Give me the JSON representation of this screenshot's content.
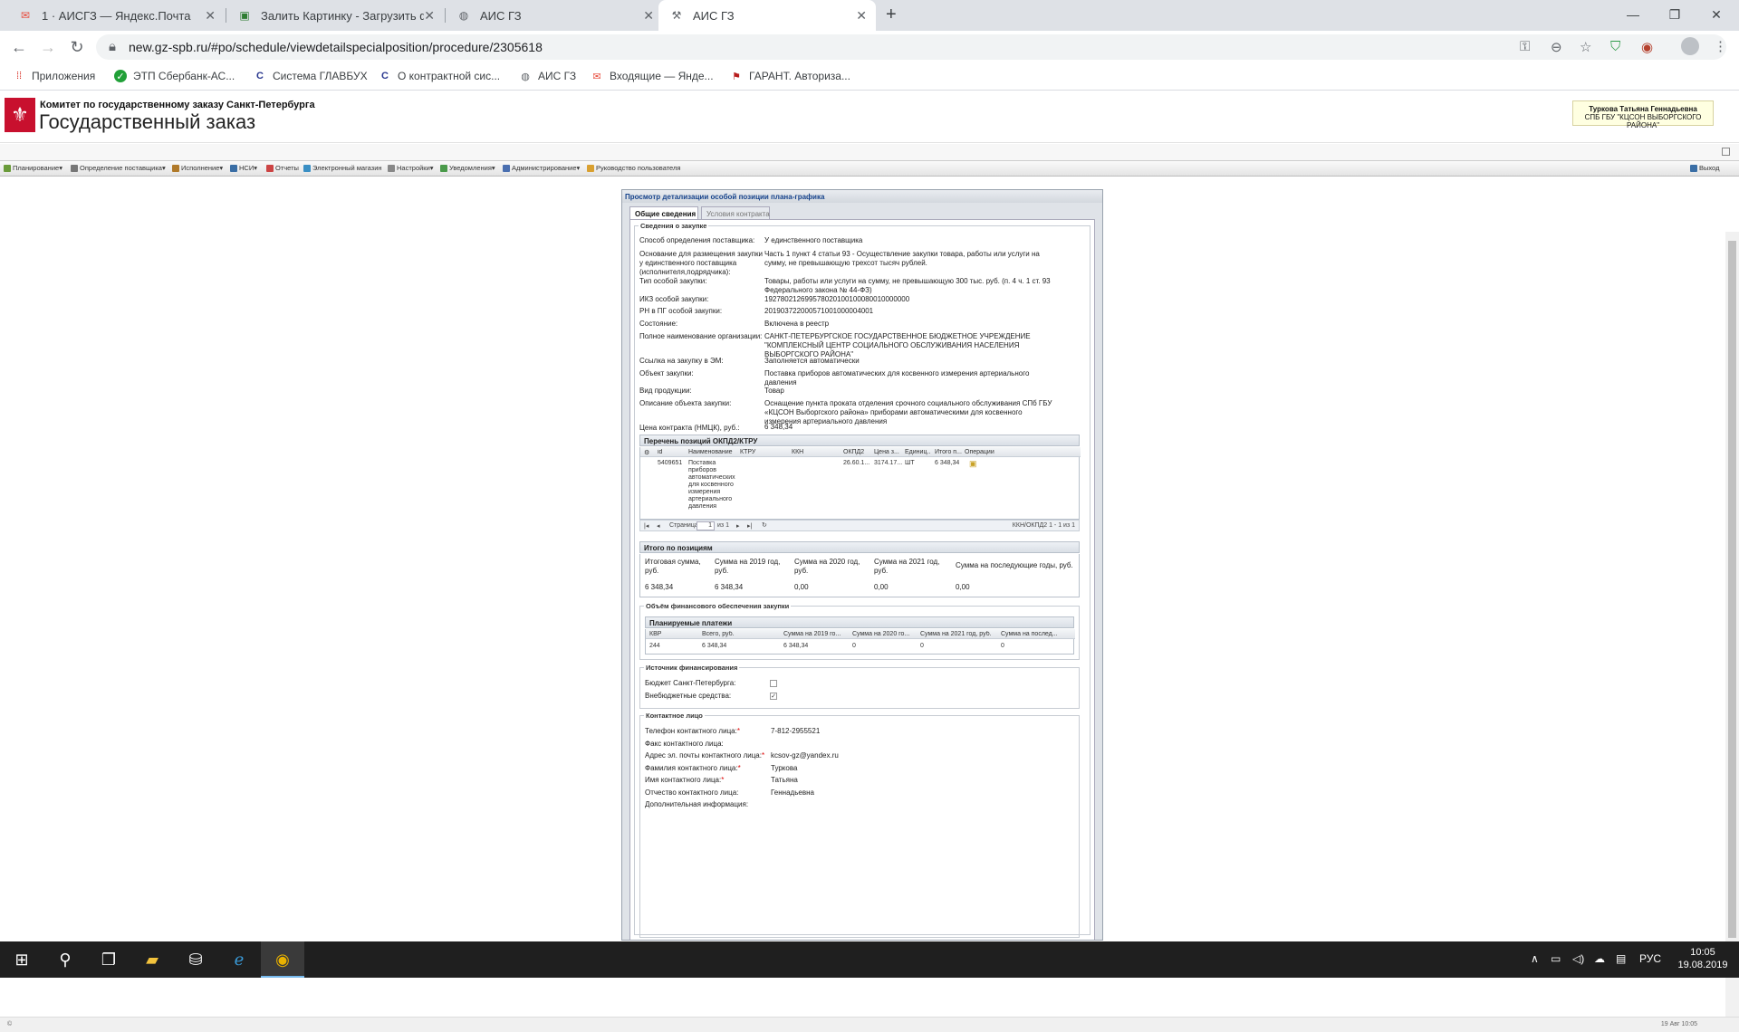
{
  "browser": {
    "tabs": [
      {
        "title": "1 · АИСГЗ — Яндекс.Почта",
        "icon": "mail-icon"
      },
      {
        "title": "Залить Картинку - Загрузить фо",
        "icon": "image-icon"
      },
      {
        "title": "АИС ГЗ",
        "icon": "globe-icon"
      },
      {
        "title": "АИС ГЗ",
        "icon": "page-icon"
      }
    ],
    "url": "new.gz-spb.ru/#po/schedule/viewdetailspecialposition/procedure/2305618",
    "bookmarks": [
      "Приложения",
      "ЭТП Сбербанк-АС...",
      "Система ГЛАВБУХ",
      "О контрактной сис...",
      "АИС ГЗ",
      "Входящие — Янде...",
      "ГАРАНТ. Авториза..."
    ]
  },
  "header": {
    "org_line": "Комитет по государственному заказу Санкт-Петербурга",
    "title": "Государственный заказ",
    "user_name": "Туркова Татьяна Геннадьевна",
    "user_org": "СПБ ГБУ \"КЦСОН ВЫБОРГСКОГО РАЙОНА\""
  },
  "menu": [
    "Планирование",
    "Определение поставщика",
    "Исполнение",
    "НСИ",
    "Отчеты",
    "Электронный магазин",
    "Настройки",
    "Уведомления",
    "Администрирование",
    "Руководство пользователя"
  ],
  "menu_exit": "Выход",
  "panel": {
    "title": "Просмотр детализации особой позиции плана-графика",
    "tabs": [
      "Общие сведения",
      "Условия контракта"
    ],
    "purchase_legend": "Сведения о закупке",
    "fields": [
      {
        "label": "Способ определения поставщика:",
        "value": "У единственного поставщика"
      },
      {
        "label": "Основание для размещения закупки у единственного поставщика (исполнителя,подрядчика):",
        "value": "Часть 1 пункт 4 статьи 93 - Осуществление закупки товара, работы или услуги на сумму, не превышающую трехсот тысяч рублей."
      },
      {
        "label": "Тип особой закупки:",
        "value": "Товары, работы или услуги на сумму, не превышающую 300 тыс. руб. (п. 4 ч. 1 ст. 93 Федерального закона № 44-ФЗ)"
      },
      {
        "label": "ИКЗ особой закупки:",
        "value": "192780212699578020100100080010000000"
      },
      {
        "label": "РН в ПГ особой закупки:",
        "value": "201903722000571001000004001"
      },
      {
        "label": "Состояние:",
        "value": "Включена в реестр"
      },
      {
        "label": "Полное наименование организации:",
        "value": "САНКТ-ПЕТЕРБУРГСКОЕ ГОСУДАРСТВЕННОЕ БЮДЖЕТНОЕ УЧРЕЖДЕНИЕ \"КОМПЛЕКСНЫЙ ЦЕНТР СОЦИАЛЬНОГО ОБСЛУЖИВАНИЯ НАСЕЛЕНИЯ ВЫБОРГСКОГО РАЙОНА\""
      },
      {
        "label": "Ссылка на закупку в ЭМ:",
        "value": "Заполняется автоматически"
      },
      {
        "label": "Объект закупки:",
        "value": "Поставка приборов автоматических для косвенного измерения артериального давления"
      },
      {
        "label": "Вид продукции:",
        "value": "Товар"
      },
      {
        "label": "Описание объекта закупки:",
        "value": "Оснащение пункта проката отделения срочного социального обслуживания СПб ГБУ «КЦСОН Выборгского района» приборами автоматическими для косвенного измерения артериального давления"
      },
      {
        "label": "Цена контракта (НМЦК), руб.:",
        "value": "6 348,34"
      }
    ],
    "okpd": {
      "title": "Перечень позиций ОКПД2/КТРУ",
      "columns": [
        "id",
        "Наименование ...",
        "КТРУ",
        "ККН",
        "ОКПД2",
        "Цена з...",
        "Единиц...",
        "Итого п...",
        "Операции"
      ],
      "row": {
        "id": "5409651",
        "name": "Поставка приборов автоматических для косвенного измерения артериального давления",
        "ktru": "",
        "kkn": "",
        "okpd": "26.60.1...",
        "price": "3174.17...",
        "unit": "ШТ",
        "total": "6 348,34"
      },
      "pager_page_label": "Страница",
      "pager_page": "1",
      "pager_of": "из 1",
      "pager_info": "ККН/ОКПД2 1 - 1 из 1"
    },
    "totals": {
      "title": "Итого по позициям",
      "headers": [
        "Итоговая сумма, руб.",
        "Сумма на 2019 год, руб.",
        "Сумма на 2020 год, руб.",
        "Сумма на 2021 год, руб.",
        "Сумма на последующие годы, руб."
      ],
      "values": [
        "6 348,34",
        "6 348,34",
        "0,00",
        "0,00",
        "0,00"
      ]
    },
    "finance": {
      "legend": "Объём финансового обеспечения закупки",
      "grid_title": "Планируемые платежи",
      "columns": [
        "КВР",
        "Всего, руб.",
        "Сумма на 2019 го...",
        "Сумма на 2020 го...",
        "Сумма на 2021 год, руб.",
        "Сумма на послед..."
      ],
      "row": [
        "244",
        "6 348,34",
        "6 348,34",
        "0",
        "0",
        "0"
      ]
    },
    "sources": {
      "legend": "Источник финансирования",
      "budget_label": "Бюджет Санкт-Петербурга:",
      "budget_checked": false,
      "extra_label": "Внебюджетные средства:",
      "extra_checked": true
    },
    "contact": {
      "legend": "Контактное лицо",
      "fields": [
        {
          "label": "Телефон контактного лица:",
          "required": true,
          "value": "7-812-2955521"
        },
        {
          "label": "Факс контактного лица:",
          "required": false,
          "value": ""
        },
        {
          "label": "Адрес эл. почты контактного лица:",
          "required": true,
          "value": "kcsov-gz@yandex.ru"
        },
        {
          "label": "Фамилия контактного лица:",
          "required": true,
          "value": "Туркова"
        },
        {
          "label": "Имя контактного лица:",
          "required": true,
          "value": "Татьяна"
        },
        {
          "label": "Отчество контактного лица:",
          "required": false,
          "value": "Геннадьевна"
        },
        {
          "label": "Дополнительная информация:",
          "required": false,
          "value": ""
        }
      ]
    }
  },
  "statusbar": {
    "left": "©",
    "right": "19 Авг 10:05"
  },
  "taskbar": {
    "time": "10:05",
    "date": "19.08.2019",
    "lang": "РУС"
  },
  "colors": {
    "accent": "#15428b",
    "logo": "#c8102e",
    "taskbar": "#1f1f1f"
  }
}
